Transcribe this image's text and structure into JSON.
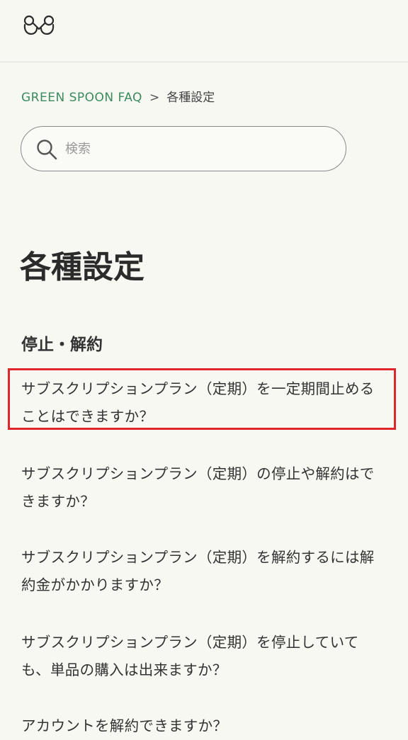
{
  "header": {
    "logo_icon": "green-spoon-logo-icon"
  },
  "breadcrumb": {
    "home": "GREEN SPOON FAQ",
    "separator": ">",
    "current": "各種設定"
  },
  "search": {
    "placeholder": "検索",
    "value": "",
    "icon": "search-icon"
  },
  "page": {
    "title": "各種設定"
  },
  "section": {
    "title": "停止・解約",
    "questions": [
      {
        "text": "サブスクリプションプラン（定期）を一定期間止めることはできますか？"
      },
      {
        "text": "サブスクリプションプラン（定期）の停止や解約はできますか？"
      },
      {
        "text": "サブスクリプションプラン（定期）を解約するには解約金がかかりますか？"
      },
      {
        "text": "サブスクリプションプラン（定期）を停止していても、単品の購入は出来ますか？"
      },
      {
        "text": "アカウントを解約できますか？"
      }
    ]
  },
  "colors": {
    "background": "#f8f8f3",
    "brand_green": "#3b8b5f",
    "highlight_red": "#e0262d"
  }
}
